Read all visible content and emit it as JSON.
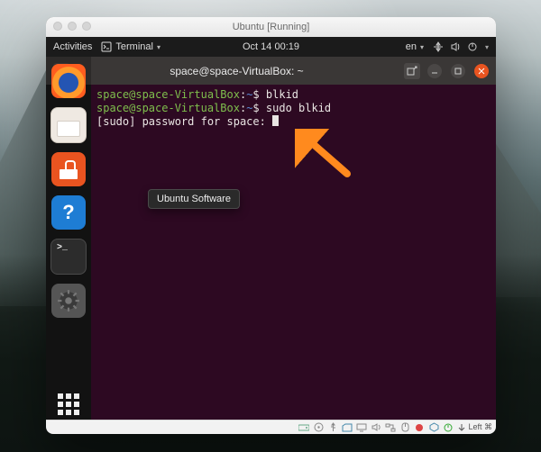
{
  "vm": {
    "window_title": "Ubuntu [Running]"
  },
  "gnome": {
    "activities": "Activities",
    "app_menu": "Terminal",
    "clock": "Oct 14  00:19",
    "lang": "en"
  },
  "terminal": {
    "title": "space@space-VirtualBox: ~",
    "user": "space",
    "host": "space-VirtualBox",
    "cwd_short": "~",
    "lines": [
      {
        "prompt_symbol": "$",
        "command": "blkid",
        "output": ""
      },
      {
        "prompt_symbol": "$",
        "command": "sudo blkid",
        "output": ""
      }
    ],
    "sudo_prompt": "[sudo] password for space: "
  },
  "dock": {
    "items": [
      "firefox",
      "files",
      "software",
      "help",
      "terminal",
      "settings"
    ],
    "tooltip": "Ubuntu Software",
    "apps_button": "Show Applications"
  },
  "statusbar": {
    "host_key": "Left ⌘",
    "indicator_icons": [
      "hdd",
      "optical",
      "usb",
      "shared",
      "display",
      "audio",
      "net",
      "record",
      "vbox",
      "power"
    ]
  },
  "colors": {
    "accent": "#e95420",
    "term_bg": "#2d0922",
    "prompt_user": "#7fbf4d",
    "prompt_path": "#5a8bd6"
  }
}
